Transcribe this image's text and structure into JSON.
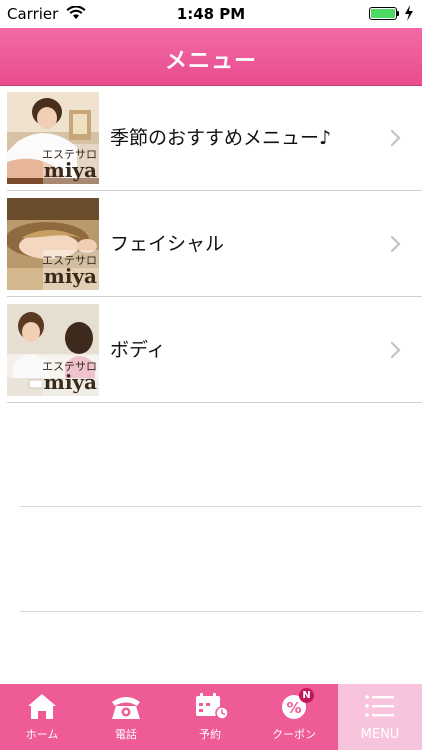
{
  "status_bar": {
    "carrier": "Carrier",
    "time": "1:48 PM",
    "battery_level": 1.0,
    "battery_color": "#4cd964"
  },
  "header": {
    "title": "メニュー",
    "background_color": "#ee5b97"
  },
  "menu": {
    "items": [
      {
        "label": "季節のおすすめメニュー♪",
        "thumb_caption_jp": "エステサロ",
        "thumb_caption_en": "miya",
        "chevron_icon": "chevron-right-icon"
      },
      {
        "label": "フェイシャル",
        "thumb_caption_jp": "エステサロ",
        "thumb_caption_en": "miya",
        "chevron_icon": "chevron-right-icon"
      },
      {
        "label": "ボディ",
        "thumb_caption_jp": "エステサロ",
        "thumb_caption_en": "miya",
        "chevron_icon": "chevron-right-icon"
      }
    ]
  },
  "tab_bar": {
    "tabs": [
      {
        "label": "ホーム",
        "icon": "home-icon",
        "active": false
      },
      {
        "label": "電話",
        "icon": "phone-icon",
        "active": false
      },
      {
        "label": "予約",
        "icon": "calendar-icon",
        "active": false
      },
      {
        "label": "クーポン",
        "icon": "coupon-icon",
        "badge": "N",
        "active": false
      },
      {
        "label": "MENU",
        "icon": "menu-list-icon",
        "active": true
      }
    ]
  }
}
